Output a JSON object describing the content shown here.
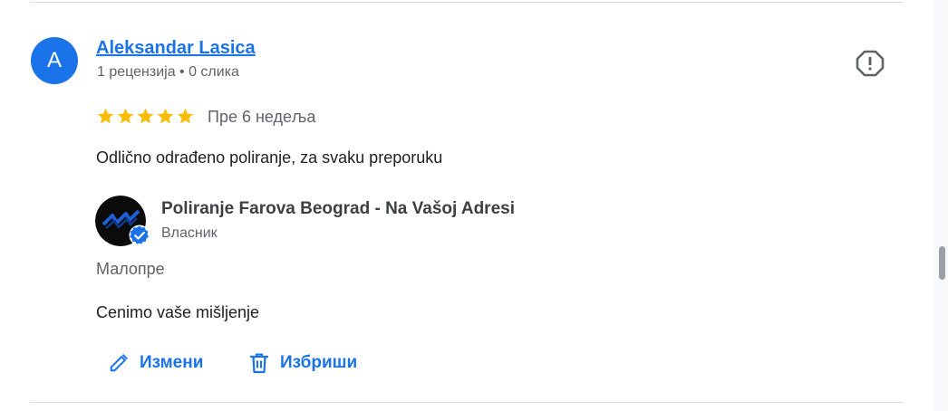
{
  "review": {
    "reviewer": {
      "initial": "A",
      "name": "Aleksandar Lasica",
      "meta": "1 рецензија • 0 слика",
      "avatar_color": "#1a73e8"
    },
    "rating": 5,
    "rating_max": 5,
    "date": "Пре 6 недеља",
    "text": "Odlično odrađeno poliranje, za svaku preporuku",
    "report_icon": "report-icon"
  },
  "owner_reply": {
    "name": "Poliranje Farova Beograd - Na Vašoj Adresi",
    "role": "Власник",
    "date": "Малопре",
    "text": "Cenimo vaše mišljenje",
    "verified_icon": "verified-check-icon"
  },
  "actions": {
    "edit_label": "Измени",
    "edit_icon": "pencil-icon",
    "delete_label": "Избриши",
    "delete_icon": "trash-icon"
  },
  "colors": {
    "accent": "#1a73e8",
    "star": "#fbbc04",
    "secondary_text": "#5f6368"
  }
}
